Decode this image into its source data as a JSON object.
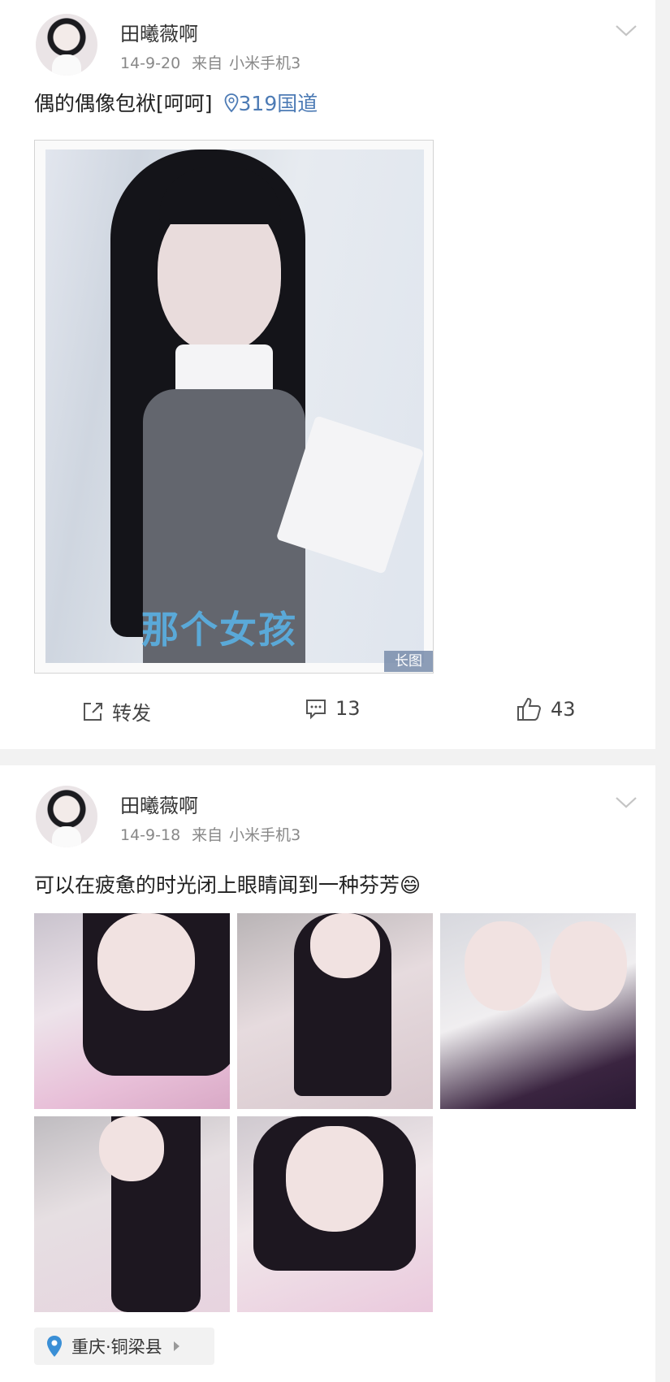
{
  "posts": [
    {
      "author": "田曦薇啊",
      "date": "14-9-20",
      "source_prefix": "来自",
      "device": "小米手机3",
      "text": "偶的偶像包袱[呵呵]",
      "location_tag": "319国道",
      "image_caption": "那个女孩",
      "image_badge": "长图",
      "actions": {
        "repost_label": "转发",
        "comments": "13",
        "likes": "43"
      }
    },
    {
      "author": "田曦薇啊",
      "date": "14-9-18",
      "source_prefix": "来自",
      "device": "小米手机3",
      "text": "可以在疲惫的时光闭上眼睛闻到一种芬芳",
      "emoji": "😄",
      "location": "重庆·铜梁县"
    }
  ],
  "colors": {
    "link_blue": "#4d7bb5",
    "location_pin": "#3a8fd6",
    "meta_gray": "#888888",
    "separator": "#f2f2f2"
  }
}
